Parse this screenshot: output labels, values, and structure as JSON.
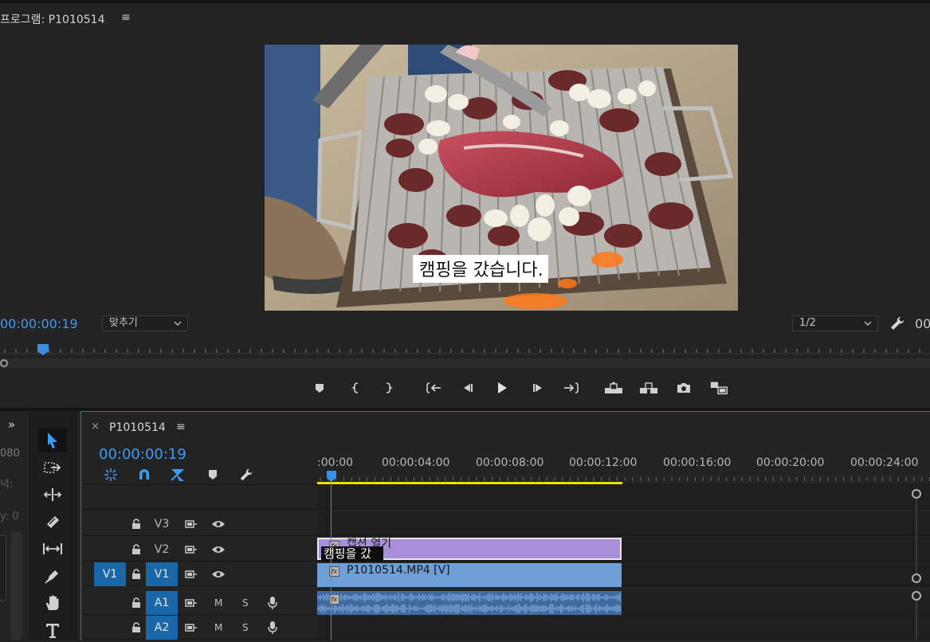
{
  "program_monitor": {
    "title": "프로그램: P1010514",
    "menu_icon": "≡",
    "caption": "캠핑을 갔습니다.",
    "timecode": "00:00:00:19",
    "fit_label": "맞추기",
    "resolution_label": "1/2",
    "duration_timecode": "00",
    "transport_icons": [
      "add-marker-icon",
      "mark-in-icon",
      "mark-out-icon",
      "go-to-in-icon",
      "step-back-icon",
      "play-icon",
      "step-forward-icon",
      "go-to-out-icon",
      "lift-icon",
      "extract-icon",
      "export-frame-icon",
      "compare-view-icon"
    ]
  },
  "left_panel": {
    "collapse": "»",
    "text1": "080",
    "text2": "녁:",
    "text3": "y:  0"
  },
  "tools": [
    "selection-tool-icon",
    "track-select-forward-icon",
    "ripple-edit-icon",
    "razor-icon",
    "slip-icon",
    "pen-icon",
    "hand-icon",
    "type-icon"
  ],
  "timeline": {
    "close": "×",
    "tab": "P1010514",
    "menu_icon": "≡",
    "timecode": "00:00:00:19",
    "ruler_labels": [
      ":00:00",
      "00:00:04:00",
      "00:00:08:00",
      "00:00:12:00",
      "00:00:16:00",
      "00:00:20:00",
      "00:00:24:00"
    ],
    "tracks": {
      "v3": {
        "name": "V3"
      },
      "v2": {
        "name": "V2"
      },
      "v1": {
        "source": "V1",
        "name": "V1"
      },
      "a1": {
        "name": "A1",
        "m": "M",
        "s": "S"
      },
      "a2": {
        "name": "A2",
        "m": "M",
        "s": "S"
      }
    },
    "clips": {
      "v2": {
        "label": "캡션 열기",
        "thumb_text": "캠핑을 갔"
      },
      "v1": {
        "label": "P1010514.MP4 [V]"
      },
      "fx": "fx"
    }
  },
  "colors": {
    "accent_blue": "#3d9bf2",
    "work_area": "#f0e000",
    "caption_clip": "#a78fd9",
    "video_clip": "#6e9fd6",
    "audio_clip": "#3f6aa0",
    "track_target": "#1a67a8"
  }
}
